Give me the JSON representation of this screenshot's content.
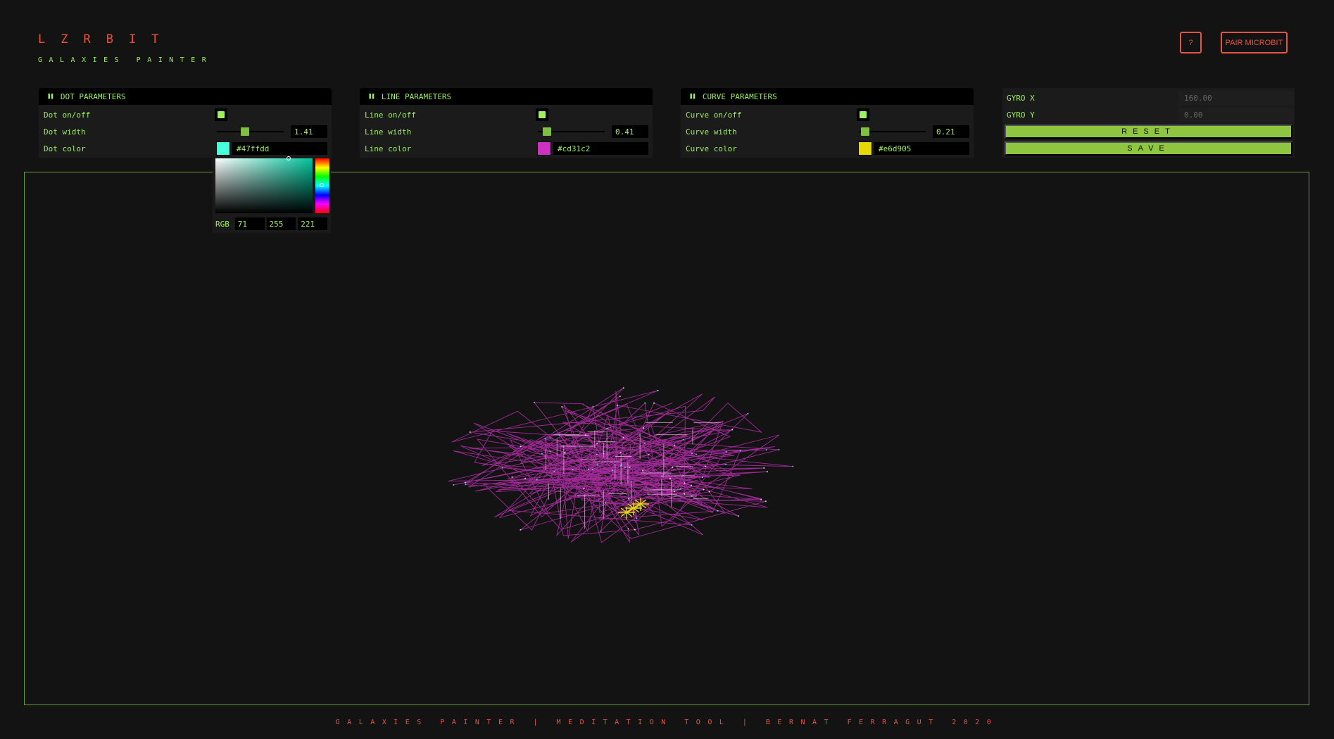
{
  "brand": {
    "title": "LZRBIT",
    "subtitle": "GALAXIES PAINTER"
  },
  "header": {
    "help_label": "?",
    "pair_label": "PAIR MICROBIT"
  },
  "panels": [
    {
      "title": "DOT PARAMETERS",
      "toggle_label": "Dot on/off",
      "width_label": "Dot width",
      "width_value": "1.41",
      "width_fraction": 0.41,
      "color_label": "Dot color",
      "color_hex": "#47ffdd"
    },
    {
      "title": "LINE PARAMETERS",
      "toggle_label": "Line on/off",
      "width_label": "Line width",
      "width_value": "0.41",
      "width_fraction": 0.08,
      "color_label": "Line color",
      "color_hex": "#cd31c2"
    },
    {
      "title": "CURVE PARAMETERS",
      "toggle_label": "Curve on/off",
      "width_label": "Curve width",
      "width_value": "0.21",
      "width_fraction": 0.04,
      "color_label": "Curve color",
      "color_hex": "#e6d905"
    }
  ],
  "gyro": {
    "x_label": "GYRO X",
    "x_value": "160.00",
    "y_label": "GYRO Y",
    "y_value": "0.00",
    "reset_label": "RESET",
    "save_label": "SAVE"
  },
  "color_picker": {
    "mode_label": "RGB",
    "r": "71",
    "g": "255",
    "b": "221"
  },
  "footer": {
    "text": "GALAXIES PAINTER | MEDITATION TOOL | BERNAT FERRAGUT 2020"
  },
  "colors": {
    "accent_red": "#e9533f",
    "accent_green": "#9df05f",
    "button_green": "#8fc63f",
    "background": "#131313"
  },
  "icons": {
    "panel_grip": "grip-icon"
  }
}
